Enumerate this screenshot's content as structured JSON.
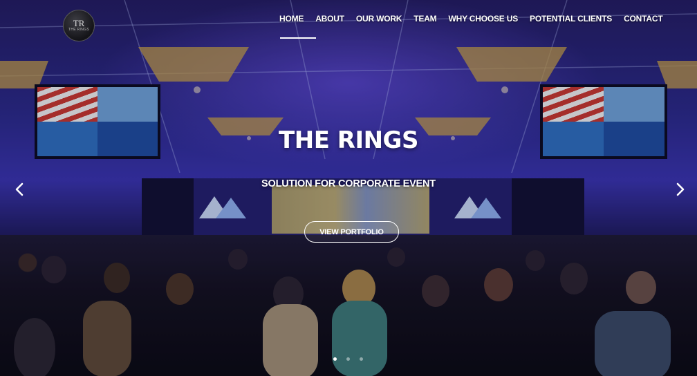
{
  "brand": {
    "logo_mark": "TR",
    "logo_subtext": "THE RINGS"
  },
  "nav": {
    "items": [
      "HOME",
      "ABOUT",
      "OUR WORK",
      "TEAM",
      "WHY CHOOSE US",
      "POTENTIAL CLIENTS",
      "CONTACT"
    ],
    "active": "HOME"
  },
  "hero": {
    "title": "THE RINGS",
    "subtitle": "SOLUTION FOR CORPORATE EVENT",
    "cta_label": "VIEW PORTFOLIO",
    "slide_count": 3,
    "active_slide": 1
  },
  "icons": {
    "prev": "chevron-left-icon",
    "next": "chevron-right-icon"
  },
  "colors": {
    "text": "#ffffff",
    "overlay": "#241d62",
    "stage_purple": "#3a34b0"
  }
}
